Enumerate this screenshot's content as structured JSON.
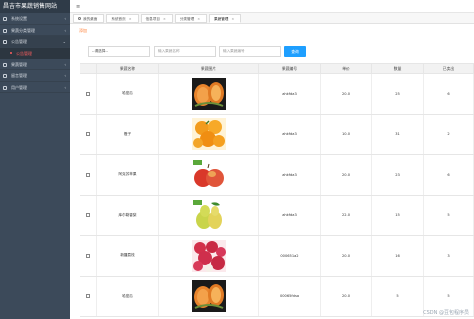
{
  "app": {
    "title": "昌吉市果蔬销售网站"
  },
  "sidebar": {
    "items": [
      {
        "label": "系统设置",
        "expanded": false
      },
      {
        "label": "果蔬分类管理",
        "expanded": false
      },
      {
        "label": "公告管理",
        "expanded": true,
        "children": [
          {
            "label": "公告管理"
          }
        ]
      },
      {
        "label": "果蔬管理",
        "expanded": false
      },
      {
        "label": "留言管理",
        "expanded": false
      },
      {
        "label": "用户管理",
        "expanded": false
      }
    ]
  },
  "tabs": [
    {
      "label": "我的桌面",
      "closable": false
    },
    {
      "label": "系统首页",
      "closable": true
    },
    {
      "label": "信息项目",
      "closable": true
    },
    {
      "label": "分类管理",
      "closable": true
    },
    {
      "label": "果蔬管理",
      "closable": true,
      "active": true
    }
  ],
  "toolbar": {
    "add_label": "添加",
    "select_value": "--请选择--",
    "name_placeholder": "输入果蔬名称",
    "code_placeholder": "输入果蔬编号",
    "search_label": "查询"
  },
  "table": {
    "headers": [
      "",
      "果蔬名称",
      "果蔬图片",
      "果蔬编号",
      "单价",
      "数量",
      "已卖出"
    ],
    "rows": [
      {
        "name": "哈密瓜",
        "image": "melon",
        "code": "ahkfda3",
        "price": "20.0",
        "qty": "25",
        "sold": "6"
      },
      {
        "name": "橙子",
        "image": "orange",
        "code": "ahkfda3",
        "price": "10.0",
        "qty": "31",
        "sold": "2"
      },
      {
        "name": "阿克苏苹果",
        "image": "apple",
        "code": "ahkfda3",
        "price": "20.0",
        "qty": "23",
        "sold": "6"
      },
      {
        "name": "库尔勒香梨",
        "image": "pear",
        "code": "ahkfda3",
        "price": "22.0",
        "qty": "15",
        "sold": "5"
      },
      {
        "name": "新疆荔枝",
        "image": "lychee",
        "code": "000651a2",
        "price": "20.0",
        "qty": "16",
        "sold": "3"
      },
      {
        "name": "哈密瓜",
        "image": "melon",
        "code": "00065fdsa",
        "price": "20.0",
        "qty": "5",
        "sold": "5"
      }
    ]
  },
  "watermark": "CSDN @豆包程序员"
}
